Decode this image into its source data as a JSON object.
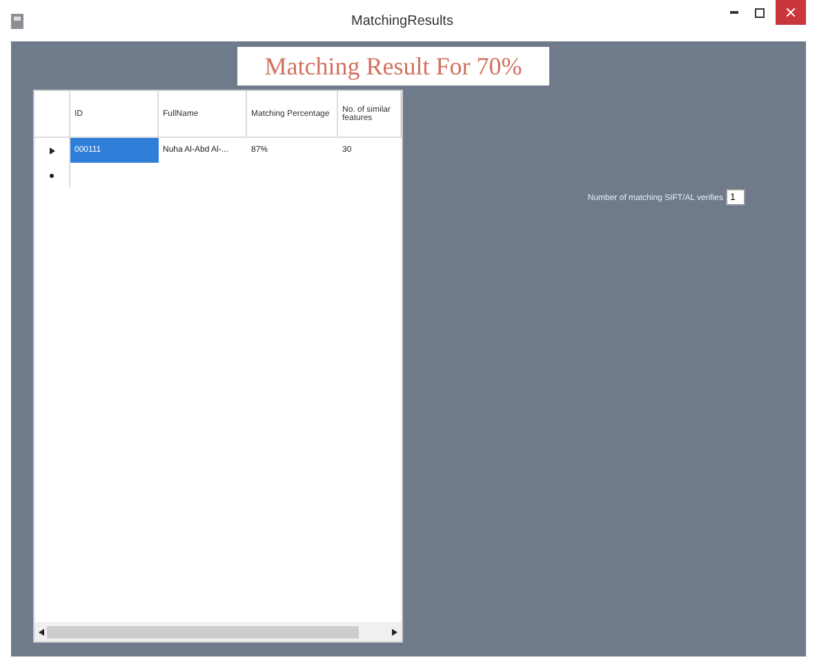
{
  "window": {
    "title": "MatchingResults"
  },
  "heading": "Matching Result For 70%",
  "table": {
    "columns": [
      "ID",
      "FullName",
      "Matching Percentage",
      "No. of similar features"
    ],
    "rows": [
      {
        "cells": [
          "000111",
          "Nuha Al-Abd Al-...",
          "87%",
          "30"
        ],
        "selected": true,
        "kind": "data"
      },
      {
        "cells": [],
        "selected": false,
        "kind": "new"
      }
    ]
  },
  "matching_count": {
    "label": "Number of matching SIFT/AL verifies",
    "value": "1"
  }
}
